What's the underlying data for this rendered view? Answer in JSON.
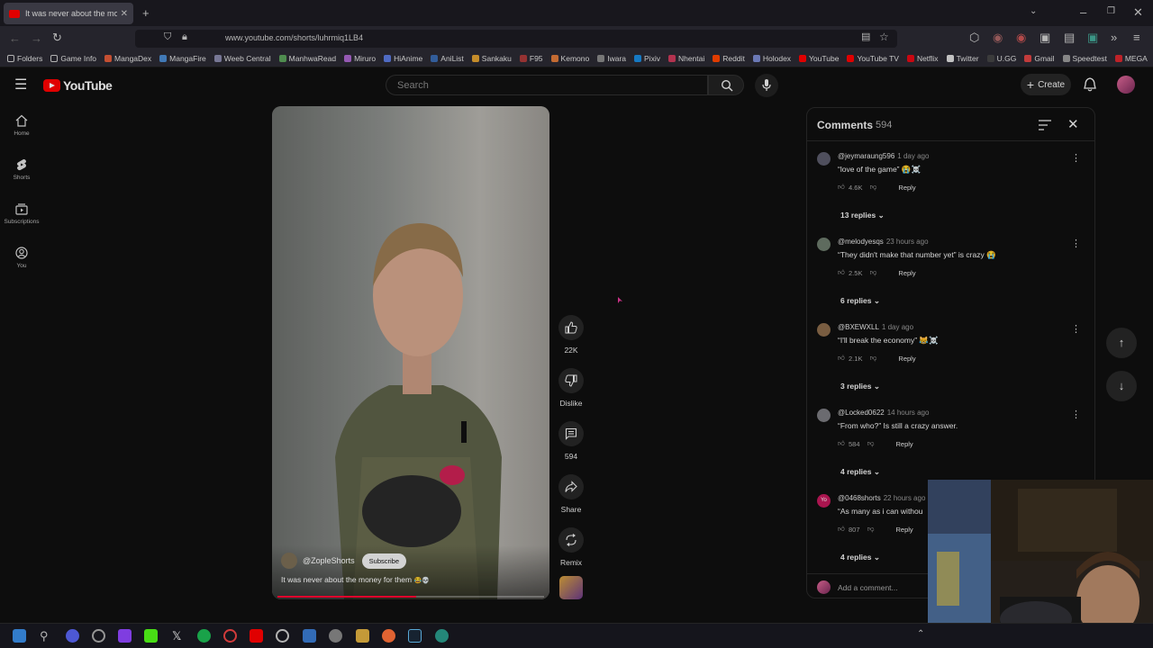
{
  "browser": {
    "tab_title": "It was never about the mon",
    "url": "www.youtube.com/shorts/luhrmiq1LB4",
    "bookmarks": [
      "Folders",
      "Game Info",
      "MangaDex",
      "MangaFire",
      "Weeb Central",
      "ManhwaRead",
      "Miruro",
      "HiAnime",
      "AniList",
      "Sankaku",
      "F95",
      "Kemono",
      "Iwara",
      "Pixiv",
      "Nhentai",
      "Reddit",
      "Holodex",
      "YouTube",
      "YouTube TV",
      "Netflix",
      "Twitter",
      "U.GG",
      "Gmail",
      "Speedtest",
      "MEGA"
    ]
  },
  "header": {
    "logo_text": "YouTube",
    "search_placeholder": "Search",
    "create_label": "Create"
  },
  "sidebar": {
    "items": [
      {
        "label": "Home",
        "icon": "home-icon"
      },
      {
        "label": "Shorts",
        "icon": "shorts-icon"
      },
      {
        "label": "Subscriptions",
        "icon": "subscriptions-icon"
      },
      {
        "label": "You",
        "icon": "you-icon"
      }
    ]
  },
  "video": {
    "channel": "@ZopleShorts",
    "subscribe_label": "Subscribe",
    "title": "It was never about the money for them",
    "title_emoji": "😂💀",
    "progress_fraction": 0.52,
    "colors": {
      "progress": "#ff0033"
    }
  },
  "actions": {
    "like_count": "22K",
    "dislike_label": "Dislike",
    "comment_count": "594",
    "share_label": "Share",
    "remix_label": "Remix"
  },
  "comments": {
    "title": "Comments",
    "count": "594",
    "add_placeholder": "Add a comment...",
    "reply_label": "Reply",
    "items": [
      {
        "author": "@jeymaraung596",
        "time": "1 day ago",
        "text": "“love of the game” 😭☠️",
        "likes": "4.6K",
        "replies": "13 replies",
        "avatar_color": "#5a5a6a"
      },
      {
        "author": "@melodyesqs",
        "time": "23 hours ago",
        "text": "“They didn't make that number yet” is crazy 😭",
        "likes": "2.5K",
        "replies": "6 replies",
        "avatar_color": "#6b7a6b"
      },
      {
        "author": "@BXEWXLL",
        "time": "1 day ago",
        "text": "“I'll break the economy” 😹☠️",
        "likes": "2.1K",
        "replies": "3 replies",
        "avatar_color": "#8a6a4a"
      },
      {
        "author": "@Locked0622",
        "time": "14 hours ago",
        "text": "“From who?” Is still a crazy answer.",
        "likes": "584",
        "replies": "4 replies",
        "avatar_color": "#7a7a80"
      },
      {
        "author": "@0468shorts",
        "time": "22 hours ago",
        "text": "“As many as i can withou",
        "likes": "807",
        "replies": "4 replies",
        "avatar_color": "#c2185b",
        "avatar_text": "Yo"
      }
    ]
  }
}
